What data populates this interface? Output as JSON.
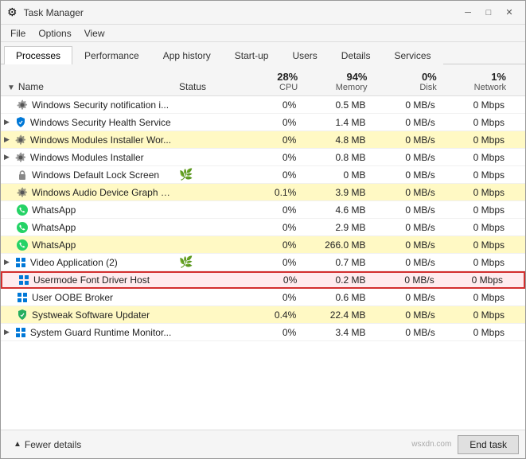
{
  "window": {
    "title": "Task Manager",
    "icon": "⚙"
  },
  "menu": {
    "items": [
      "File",
      "Options",
      "View"
    ]
  },
  "tabs": [
    {
      "label": "Processes",
      "active": true
    },
    {
      "label": "Performance",
      "active": false
    },
    {
      "label": "App history",
      "active": false
    },
    {
      "label": "Start-up",
      "active": false
    },
    {
      "label": "Users",
      "active": false
    },
    {
      "label": "Details",
      "active": false
    },
    {
      "label": "Services",
      "active": false
    }
  ],
  "columns": {
    "name": "Name",
    "status": "Status",
    "cpu": {
      "pct": "28%",
      "label": "CPU"
    },
    "memory": {
      "pct": "94%",
      "label": "Memory"
    },
    "disk": {
      "pct": "0%",
      "label": "Disk"
    },
    "network": {
      "pct": "1%",
      "label": "Network"
    }
  },
  "rows": [
    {
      "id": 1,
      "indent": 1,
      "icon": "gear",
      "name": "Windows Security notification i...",
      "status": "",
      "cpu": "0%",
      "memory": "0.5 MB",
      "disk": "0 MB/s",
      "network": "0 Mbps",
      "highlight": false,
      "selected": false,
      "expand": false
    },
    {
      "id": 2,
      "indent": 0,
      "icon": "shield",
      "name": "Windows Security Health Service",
      "status": "",
      "cpu": "0%",
      "memory": "1.4 MB",
      "disk": "0 MB/s",
      "network": "0 Mbps",
      "highlight": false,
      "selected": false,
      "expand": true
    },
    {
      "id": 3,
      "indent": 0,
      "icon": "gear",
      "name": "Windows Modules Installer Wor...",
      "status": "",
      "cpu": "0%",
      "memory": "4.8 MB",
      "disk": "0 MB/s",
      "network": "0 Mbps",
      "highlight": true,
      "selected": false,
      "expand": true
    },
    {
      "id": 4,
      "indent": 0,
      "icon": "gear",
      "name": "Windows Modules Installer",
      "status": "",
      "cpu": "0%",
      "memory": "0.8 MB",
      "disk": "0 MB/s",
      "network": "0 Mbps",
      "highlight": false,
      "selected": false,
      "expand": true
    },
    {
      "id": 5,
      "indent": 0,
      "icon": "lock",
      "name": "Windows Default Lock Screen",
      "status": "🌿",
      "cpu": "0%",
      "memory": "0 MB",
      "disk": "0 MB/s",
      "network": "0 Mbps",
      "highlight": false,
      "selected": false,
      "expand": false
    },
    {
      "id": 6,
      "indent": 0,
      "icon": "gear",
      "name": "Windows Audio Device Graph Is...",
      "status": "",
      "cpu": "0.1%",
      "memory": "3.9 MB",
      "disk": "0 MB/s",
      "network": "0 Mbps",
      "highlight": true,
      "selected": false,
      "expand": false
    },
    {
      "id": 7,
      "indent": 0,
      "icon": "whatsapp",
      "name": "WhatsApp",
      "status": "",
      "cpu": "0%",
      "memory": "4.6 MB",
      "disk": "0 MB/s",
      "network": "0 Mbps",
      "highlight": false,
      "selected": false,
      "expand": false
    },
    {
      "id": 8,
      "indent": 0,
      "icon": "whatsapp",
      "name": "WhatsApp",
      "status": "",
      "cpu": "0%",
      "memory": "2.9 MB",
      "disk": "0 MB/s",
      "network": "0 Mbps",
      "highlight": false,
      "selected": false,
      "expand": false
    },
    {
      "id": 9,
      "indent": 0,
      "icon": "whatsapp",
      "name": "WhatsApp",
      "status": "",
      "cpu": "0%",
      "memory": "266.0 MB",
      "disk": "0 MB/s",
      "network": "0 Mbps",
      "highlight": true,
      "selected": false,
      "expand": false
    },
    {
      "id": 10,
      "indent": 0,
      "icon": "app",
      "name": "Video Application (2)",
      "status": "🌿",
      "cpu": "0%",
      "memory": "0.7 MB",
      "disk": "0 MB/s",
      "network": "0 Mbps",
      "highlight": false,
      "selected": false,
      "expand": true
    },
    {
      "id": 11,
      "indent": 0,
      "icon": "app",
      "name": "Usermode Font Driver Host",
      "status": "",
      "cpu": "0%",
      "memory": "0.2 MB",
      "disk": "0 MB/s",
      "network": "0 Mbps",
      "highlight": false,
      "selected": true,
      "expand": false
    },
    {
      "id": 12,
      "indent": 0,
      "icon": "app",
      "name": "User OOBE Broker",
      "status": "",
      "cpu": "0%",
      "memory": "0.6 MB",
      "disk": "0 MB/s",
      "network": "0 Mbps",
      "highlight": false,
      "selected": false,
      "expand": false
    },
    {
      "id": 13,
      "indent": 0,
      "icon": "shield2",
      "name": "Systweak Software Updater",
      "status": "",
      "cpu": "0.4%",
      "memory": "22.4 MB",
      "disk": "0 MB/s",
      "network": "0 Mbps",
      "highlight": true,
      "selected": false,
      "expand": false
    },
    {
      "id": 14,
      "indent": 0,
      "icon": "app",
      "name": "System Guard Runtime Monitor...",
      "status": "",
      "cpu": "0%",
      "memory": "3.4 MB",
      "disk": "0 MB/s",
      "network": "0 Mbps",
      "highlight": false,
      "selected": false,
      "expand": true
    }
  ],
  "footer": {
    "fewer_details": "Fewer details",
    "end_task": "End task"
  },
  "watermark": "wsxdn.com"
}
